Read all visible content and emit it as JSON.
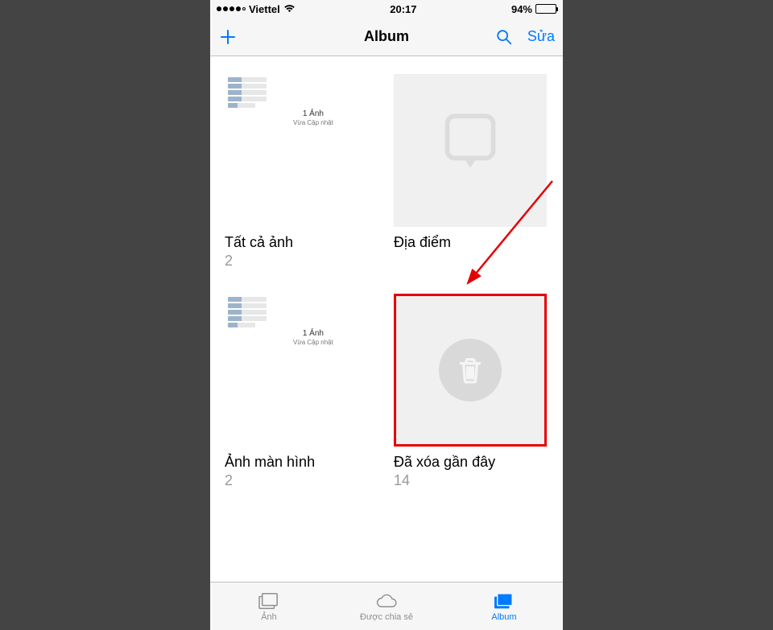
{
  "status": {
    "carrier": "Viettel",
    "time": "20:17",
    "battery_text": "94%",
    "battery_level": 94
  },
  "nav": {
    "title": "Album",
    "edit_label": "Sửa"
  },
  "albums": [
    {
      "title": "Tất cả ảnh",
      "count": "2",
      "caption_main": "1 Ảnh",
      "caption_sub": "Vừa Cập nhật"
    },
    {
      "title": "Địa điểm",
      "count": ""
    },
    {
      "title": "Ảnh màn hình",
      "count": "2",
      "caption_main": "1 Ảnh",
      "caption_sub": "Vừa Cập nhật"
    },
    {
      "title": "Đã xóa gần đây",
      "count": "14"
    }
  ],
  "tabs": {
    "photos": "Ảnh",
    "shared": "Được chia sẻ",
    "album": "Album"
  },
  "colors": {
    "accent": "#007aff",
    "highlight": "#e40000"
  }
}
